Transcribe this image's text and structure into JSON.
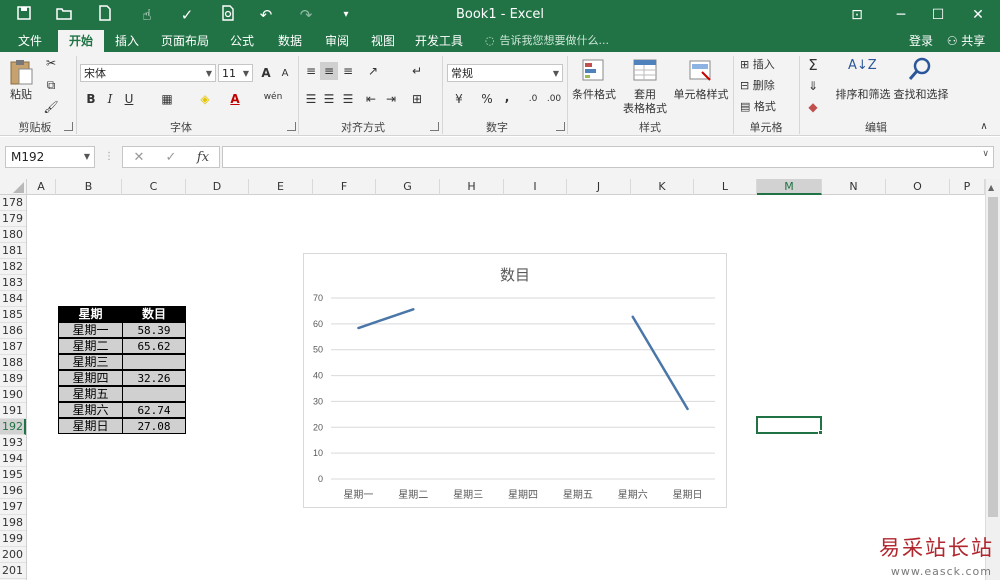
{
  "window": {
    "title": "Book1 - Excel",
    "controls": [
      "⊡",
      "─",
      "☐",
      "✕"
    ]
  },
  "qat": {
    "icons": [
      "save-icon",
      "open-icon",
      "new-icon",
      "touch-mode-icon",
      "spelling-icon",
      "print-preview-icon",
      "undo-icon",
      "redo-icon",
      "customize-icon"
    ]
  },
  "tabs": [
    {
      "label": "文件"
    },
    {
      "label": "开始"
    },
    {
      "label": "插入"
    },
    {
      "label": "页面布局"
    },
    {
      "label": "公式"
    },
    {
      "label": "数据"
    },
    {
      "label": "审阅"
    },
    {
      "label": "视图"
    },
    {
      "label": "开发工具"
    }
  ],
  "active_tab": "开始",
  "tell_me": "告诉我您想要做什么...",
  "account": {
    "signin": "登录",
    "share": "共享"
  },
  "ribbon": {
    "clipboard": {
      "paste": "粘贴",
      "group": "剪贴板"
    },
    "font": {
      "name": "宋体",
      "size": "11",
      "bold": "B",
      "italic": "I",
      "underline": "U",
      "group": "字体",
      "grow": "A",
      "shrink": "A",
      "color_letter": "A",
      "phonetic": "wén"
    },
    "alignment": {
      "group": "对齐方式"
    },
    "number": {
      "format": "常规",
      "group": "数字",
      "percent": "%",
      "comma": ",",
      "currency": "¥"
    },
    "styles": {
      "conditional": "条件格式",
      "table1": "套用",
      "table2": "表格格式",
      "cell_styles": "单元格样式",
      "group": "样式"
    },
    "cells": {
      "insert": "插入",
      "delete": "删除",
      "format": "格式",
      "group": "单元格"
    },
    "editing": {
      "sort": "排序和筛选",
      "find": "查找和选择",
      "group": "编辑"
    }
  },
  "formula_bar": {
    "name_box": "M192",
    "cancel": "✕",
    "enter": "✓",
    "fx": "fx",
    "value": ""
  },
  "columns": [
    "A",
    "B",
    "C",
    "D",
    "E",
    "F",
    "G",
    "H",
    "I",
    "J",
    "K",
    "L",
    "M",
    "N",
    "O",
    "P"
  ],
  "selected_column": "M",
  "rows": [
    "178",
    "179",
    "180",
    "181",
    "182",
    "183",
    "184",
    "185",
    "186",
    "187",
    "188",
    "189",
    "190",
    "191",
    "192",
    "193",
    "194",
    "195",
    "196",
    "197",
    "198",
    "199",
    "200",
    "201"
  ],
  "selected_row": "192",
  "table": {
    "headers": [
      "星期",
      "数目"
    ],
    "rows": [
      {
        "day": "星期一",
        "value": "58.39"
      },
      {
        "day": "星期二",
        "value": "65.62"
      },
      {
        "day": "星期三",
        "value": ""
      },
      {
        "day": "星期四",
        "value": "32.26"
      },
      {
        "day": "星期五",
        "value": ""
      },
      {
        "day": "星期六",
        "value": "62.74"
      },
      {
        "day": "星期日",
        "value": "27.08"
      }
    ]
  },
  "chart_data": {
    "type": "line",
    "title": "数目",
    "categories": [
      "星期一",
      "星期二",
      "星期三",
      "星期四",
      "星期五",
      "星期六",
      "星期日"
    ],
    "series": [
      {
        "values": [
          58.39,
          65.62,
          null,
          null,
          null,
          62.74,
          27.08
        ],
        "color": "#4a76a8"
      }
    ],
    "ylim": [
      0,
      70
    ],
    "yticks": [
      0,
      10,
      20,
      30,
      40,
      50,
      60,
      70
    ],
    "grid": true,
    "gaps": "empty"
  },
  "watermark": {
    "text": "易采站长站",
    "url": "www.easck.com"
  },
  "colors": {
    "accent": "#217346",
    "ribbon": "#f3f3f3",
    "line": "#4a76a8"
  }
}
